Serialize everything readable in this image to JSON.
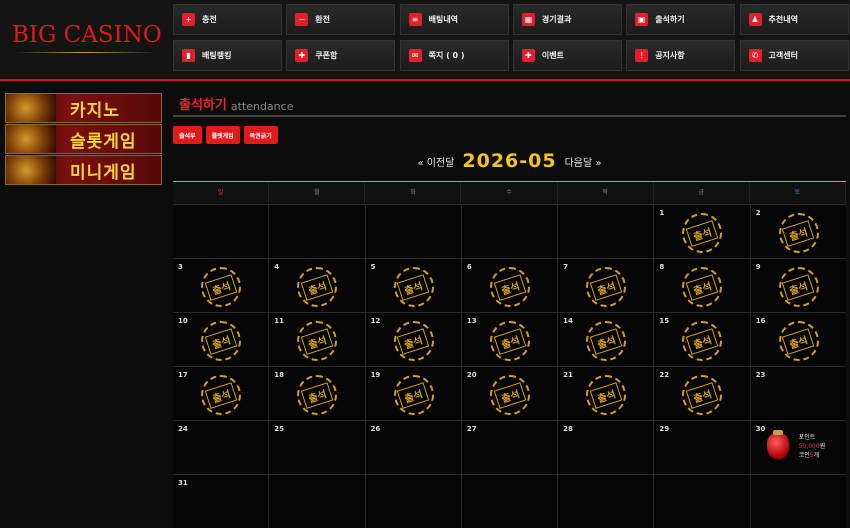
{
  "logo": "BIG CASINO",
  "nav": [
    {
      "label": "충전",
      "icon": "plus-icon"
    },
    {
      "label": "환전",
      "icon": "minus-icon"
    },
    {
      "label": "배팅내역",
      "icon": "list-icon"
    },
    {
      "label": "경기결과",
      "icon": "scoreboard-icon"
    },
    {
      "label": "출석하기",
      "icon": "calendar-icon"
    },
    {
      "label": "추천내역",
      "icon": "user-plus-icon"
    },
    {
      "label": "배팅랭킹",
      "icon": "ranking-icon"
    },
    {
      "label": "쿠폰함",
      "icon": "gift-icon"
    },
    {
      "label": "쪽지 ( 0 )",
      "icon": "envelope-icon"
    },
    {
      "label": "이벤트",
      "icon": "gift-box-icon"
    },
    {
      "label": "공지사항",
      "icon": "alert-icon"
    },
    {
      "label": "고객센터",
      "icon": "phone-icon"
    }
  ],
  "sidebar": [
    {
      "label": "카지노"
    },
    {
      "label": "슬롯게임"
    },
    {
      "label": "미니게임"
    }
  ],
  "page": {
    "title": "출석하기",
    "subtitle": "attendance",
    "buttons": [
      "출석부",
      "룰렛게임",
      "복권긁기"
    ],
    "prev_label": "« 이전달",
    "month": "2026-05",
    "next_label": "다음달 »"
  },
  "calendar": {
    "weekdays": [
      "일",
      "월",
      "화",
      "수",
      "목",
      "금",
      "토"
    ],
    "stamp_text": "출석",
    "weeks": [
      [
        null,
        null,
        null,
        null,
        null,
        {
          "day": "1",
          "stamp": true
        },
        {
          "day": "2",
          "stamp": true
        }
      ],
      [
        {
          "day": "3",
          "stamp": true
        },
        {
          "day": "4",
          "stamp": true
        },
        {
          "day": "5",
          "stamp": true
        },
        {
          "day": "6",
          "stamp": true
        },
        {
          "day": "7",
          "stamp": true
        },
        {
          "day": "8",
          "stamp": true
        },
        {
          "day": "9",
          "stamp": true
        }
      ],
      [
        {
          "day": "10",
          "stamp": true
        },
        {
          "day": "11",
          "stamp": true
        },
        {
          "day": "12",
          "stamp": true
        },
        {
          "day": "13",
          "stamp": true
        },
        {
          "day": "14",
          "stamp": true
        },
        {
          "day": "15",
          "stamp": true
        },
        {
          "day": "16",
          "stamp": true
        }
      ],
      [
        {
          "day": "17",
          "stamp": true
        },
        {
          "day": "18",
          "stamp": true
        },
        {
          "day": "19",
          "stamp": true
        },
        {
          "day": "20",
          "stamp": true
        },
        {
          "day": "21",
          "stamp": true
        },
        {
          "day": "22",
          "stamp": true
        },
        {
          "day": "23",
          "stamp": false
        }
      ],
      [
        {
          "day": "24",
          "stamp": false
        },
        {
          "day": "25",
          "stamp": false
        },
        {
          "day": "26",
          "stamp": false
        },
        {
          "day": "27",
          "stamp": false
        },
        {
          "day": "28",
          "stamp": false
        },
        {
          "day": "29",
          "stamp": false
        },
        {
          "day": "30",
          "stamp": false,
          "reward": true
        }
      ],
      [
        {
          "day": "31",
          "stamp": false
        },
        null,
        null,
        null,
        null,
        null,
        null
      ]
    ],
    "reward": {
      "line1": "포인트",
      "points": "50,000",
      "points_unit": "원",
      "coin_prefix": "코인",
      "coins": "5",
      "coin_unit": "개"
    }
  }
}
